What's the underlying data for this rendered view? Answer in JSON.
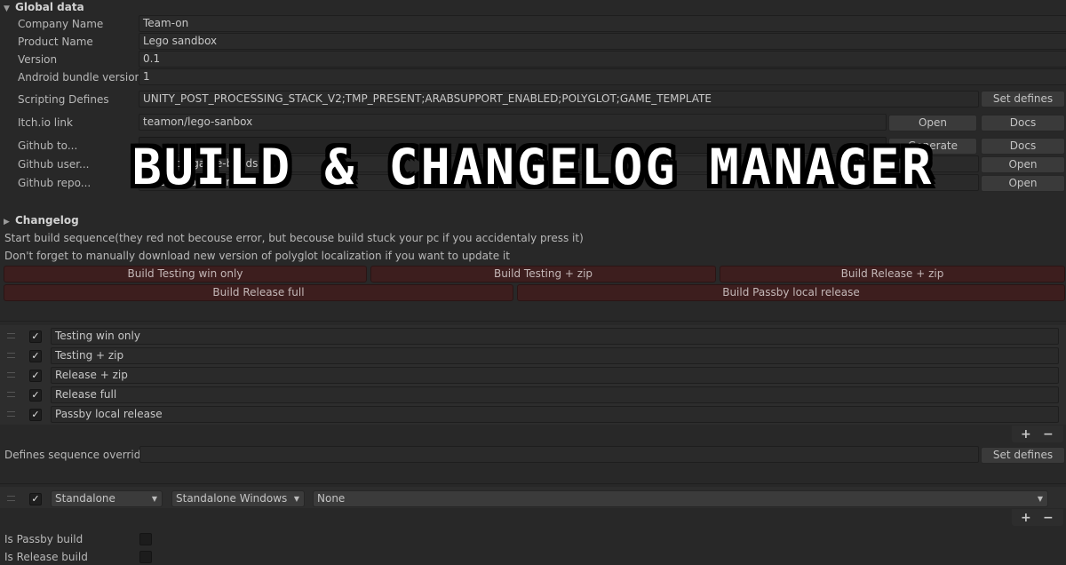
{
  "global": {
    "header": "Global data",
    "company_label": "Company Name",
    "company_value": "Team-on",
    "product_label": "Product Name",
    "product_value": "Lego sandbox",
    "version_label": "Version",
    "version_value": "0.1",
    "android_label": "Android bundle version",
    "android_value": "1",
    "defines_label": "Scripting Defines",
    "defines_value": "UNITY_POST_PROCESSING_STACK_V2;TMP_PRESENT;ARABSUPPORT_ENABLED;POLYGLOT;GAME_TEMPLATE",
    "set_defines": "Set defines",
    "itch_label": "Itch.io link",
    "itch_value": "teamon/lego-sanbox",
    "open": "Open",
    "docs": "Docs",
    "github_token_label": "Github to...",
    "github_token_btn": "Generate",
    "github_user_label": "Github user...",
    "github_user_value": "Team-on/game-builds",
    "github_repo_label": "Github repo...",
    "github_repo_value": "lego-release-game"
  },
  "changelog": {
    "header": "Changelog"
  },
  "build": {
    "info1": "Start build sequence(they red not becouse error, but becouse build stuck your pc if you accidentaly press it)",
    "info2": "Don't forget to manually download new version of polyglot localization if you want to update it",
    "row1": [
      "Build Testing win only",
      "Build Testing + zip",
      "Build Release + zip"
    ],
    "row2": [
      "Build Release full",
      "Build Passby local release"
    ]
  },
  "sequence_list": {
    "items": [
      {
        "label": "Testing win only",
        "checked": true
      },
      {
        "label": "Testing + zip",
        "checked": true
      },
      {
        "label": "Release + zip",
        "checked": true
      },
      {
        "label": "Release full",
        "checked": true
      },
      {
        "label": "Passby local release",
        "checked": true
      }
    ],
    "add": "+",
    "remove": "−"
  },
  "override": {
    "label": "Defines sequence override",
    "value": "",
    "set_defines": "Set defines"
  },
  "target_list": {
    "item": {
      "checked": true,
      "group": "Standalone",
      "target": "Standalone Windows",
      "options": "None"
    },
    "add": "+",
    "remove": "−"
  },
  "flags": {
    "passby_label": "Is Passby build",
    "release_label": "Is Release build"
  },
  "banner": {
    "title": "Build & Changelog Manager"
  },
  "colors": {
    "background": "#282828",
    "build_button": "#3d1e1e",
    "banner_text": "#ffffff",
    "banner_outline": "#000000"
  }
}
